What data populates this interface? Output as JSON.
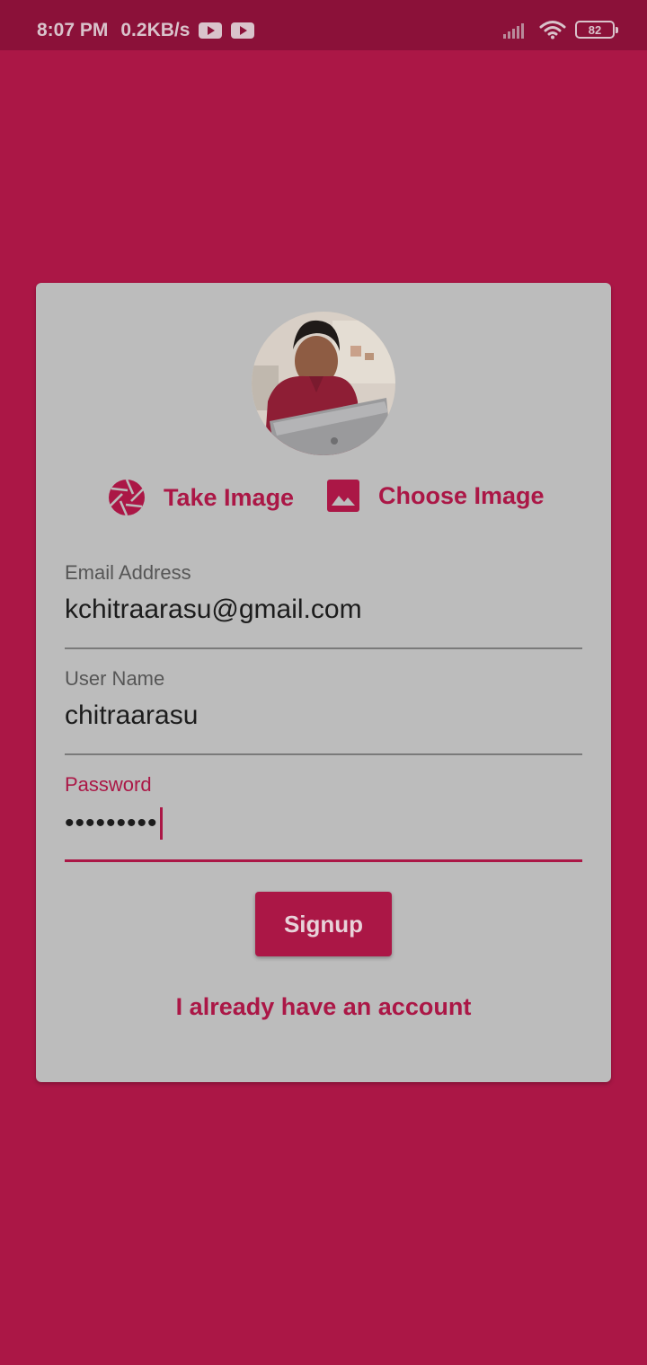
{
  "status_bar": {
    "time": "8:07 PM",
    "network_speed": "0.2KB/s",
    "battery_level": "82",
    "icons": [
      "youtube-icon",
      "youtube-icon",
      "signal-icon",
      "wifi-icon",
      "battery-icon"
    ]
  },
  "colors": {
    "primary": "#ab1746",
    "status_bar": "#8b1139",
    "card": "#bcbcbc"
  },
  "profile": {
    "avatar_icon": "user-photo"
  },
  "image_actions": {
    "take_label": "Take Image",
    "take_icon": "camera-shutter-icon",
    "choose_label": "Choose Image",
    "choose_icon": "image-icon"
  },
  "form": {
    "email": {
      "label": "Email Address",
      "value": "kchitraarasu@gmail.com"
    },
    "username": {
      "label": "User Name",
      "value": "chitraarasu"
    },
    "password": {
      "label": "Password",
      "value": "•••••••••"
    }
  },
  "signup_label": "Signup",
  "login_link_label": "I already have an account"
}
